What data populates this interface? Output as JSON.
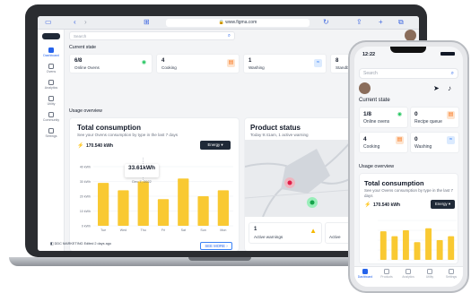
{
  "browser": {
    "url": "www.figma.com"
  },
  "sidebar": {
    "items": [
      {
        "label": "Dashboard",
        "icon": "dashboard-icon",
        "active": true
      },
      {
        "label": "Ovens",
        "icon": "oven-icon"
      },
      {
        "label": "Analytics",
        "icon": "analytics-icon"
      },
      {
        "label": "Utility",
        "icon": "utility-icon"
      },
      {
        "label": "Community",
        "icon": "community-icon"
      },
      {
        "label": "Settings",
        "icon": "settings-icon"
      }
    ]
  },
  "search": {
    "placeholder": "Search"
  },
  "current_state": {
    "title": "Current state",
    "cards": [
      {
        "value": "6/8",
        "label": "Online Ovens",
        "icon": "wifi-icon",
        "color": "#22c55e"
      },
      {
        "value": "4",
        "label": "Cooking",
        "icon": "cooking-icon",
        "color": "#f97316"
      },
      {
        "value": "1",
        "label": "Washing",
        "icon": "washing-icon",
        "color": "#3b82f6"
      },
      {
        "value": "8",
        "label": "Standb",
        "icon": "standby-icon",
        "color": "#6b7280"
      }
    ]
  },
  "usage": {
    "title": "Usage overview",
    "consumption": {
      "title": "Total consumption",
      "subtitle": "See your Ovens consumption by type in the last 7 days",
      "total": "170.540 kWh",
      "filter": "Energy",
      "tooltip_value": "33.61kWh",
      "tooltip_date": "Dec 7, 2022",
      "see_more": "SEE MORE"
    }
  },
  "chart_data": {
    "type": "bar",
    "categories": [
      "Tue",
      "Wed",
      "Thu",
      "Fri",
      "Sat",
      "Sun",
      "Mon"
    ],
    "values": [
      29,
      24,
      30,
      18,
      32,
      20,
      24
    ],
    "ytick_labels": [
      "40 kWh",
      "30 kWh",
      "20 kWh",
      "10 kWh",
      "0 kWh"
    ],
    "ylim": [
      0,
      40
    ],
    "color": "#f9c932",
    "highlight_index": 2
  },
  "product_status": {
    "title": "Product status",
    "subtitle": "Today 9:41am, 1 active warning",
    "warning_value": "1",
    "warning_label": "Active warnings",
    "active_label": "Active"
  },
  "footer": {
    "text": "DDC MARKETING  Edited 2 days ago"
  },
  "phone": {
    "time": "12:22",
    "search_placeholder": "Search",
    "current_state": "Current state",
    "cards": [
      {
        "value": "1/8",
        "label": "Online ovens",
        "icon": "wifi-icon",
        "color": "#22c55e"
      },
      {
        "value": "0",
        "label": "Recipe queue",
        "icon": "recipe-icon",
        "color": "#f97316"
      },
      {
        "value": "4",
        "label": "Cooking",
        "icon": "cooking-icon",
        "color": "#f97316"
      },
      {
        "value": "0",
        "label": "Washing",
        "icon": "washing-icon",
        "color": "#3b82f6"
      }
    ],
    "usage": "Usage overview",
    "consumption_title": "Total consumption",
    "consumption_sub": "See your Ovens consumption by type in the last 7 days",
    "total": "170.540 kWh",
    "filter": "Energy",
    "tabs": [
      {
        "label": "Dashboard",
        "active": true
      },
      {
        "label": "Products"
      },
      {
        "label": "Analytics"
      },
      {
        "label": "Utility"
      },
      {
        "label": "Settings"
      }
    ]
  }
}
